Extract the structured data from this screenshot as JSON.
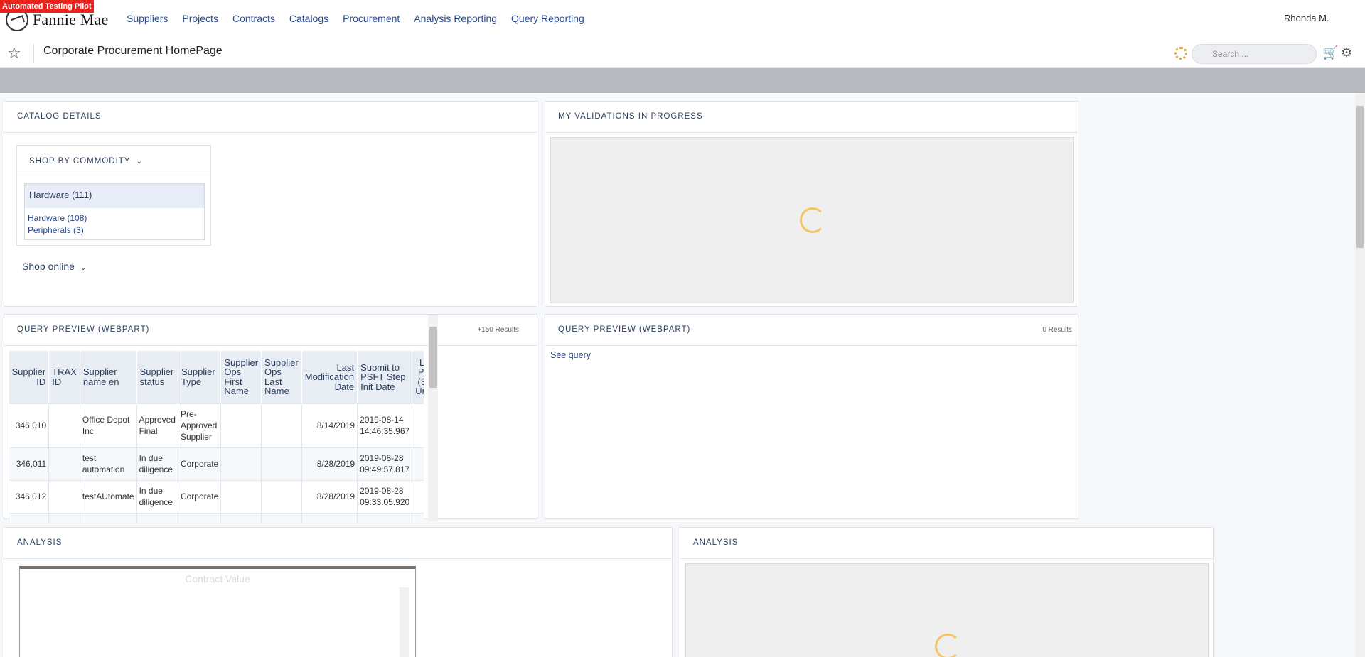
{
  "badge": "Automated Testing Pilot",
  "logo": {
    "text": "Fannie Mae"
  },
  "nav": [
    "Suppliers",
    "Projects",
    "Contracts",
    "Catalogs",
    "Procurement",
    "Analysis Reporting",
    "Query Reporting"
  ],
  "user": "Rhonda M.",
  "page_title": "Corporate Procurement HomePage",
  "search": {
    "placeholder": "Search ..."
  },
  "catalog": {
    "title": "CATALOG DETAILS",
    "commodity_label": "SHOP BY COMMODITY",
    "selected": "Hardware (111)",
    "items": [
      "Hardware (108)",
      "Peripherals (3)"
    ],
    "shop_online": "Shop online"
  },
  "validations": {
    "title": "MY VALIDATIONS IN PROGRESS"
  },
  "query1": {
    "title": "QUERY PREVIEW (WEBPART)",
    "count": "+150 Results",
    "columns": [
      "Supplier ID",
      "TRAX ID",
      "Supplier name en",
      "Supplier status",
      "Supplier Type",
      "Supplier Ops First Name",
      "Supplier Ops Last Name",
      "Last Modification Date",
      "Submit to PSFT Step Init Date",
      "Loaded to PSFT Flag (Should be Unchecked)"
    ],
    "rows": [
      [
        "346,010",
        "",
        "Office Depot Inc",
        "Approved Final",
        "Pre-Approved Supplier",
        "",
        "",
        "8/14/2019",
        "2019-08-14 14:46:35.967",
        ""
      ],
      [
        "346,011",
        "",
        "test automation",
        "In due diligence",
        "Corporate",
        "",
        "",
        "8/28/2019",
        "2019-08-28 09:49:57.817",
        ""
      ],
      [
        "346,012",
        "",
        "testAUtomate",
        "In due diligence",
        "Corporate",
        "",
        "",
        "8/28/2019",
        "2019-08-28 09:33:05.920",
        ""
      ]
    ]
  },
  "query2": {
    "title": "QUERY PREVIEW (WEBPART)",
    "count": "0 Results",
    "link": "See query"
  },
  "analysis1": {
    "title": "ANALYSIS",
    "chart_title": "Contract Value"
  },
  "analysis2": {
    "title": "ANALYSIS"
  },
  "colors": {
    "nav": "#2a4a8c",
    "badge": "#e8231c",
    "graybar": "#b8bcc1",
    "spinner": "#f4c55f"
  }
}
